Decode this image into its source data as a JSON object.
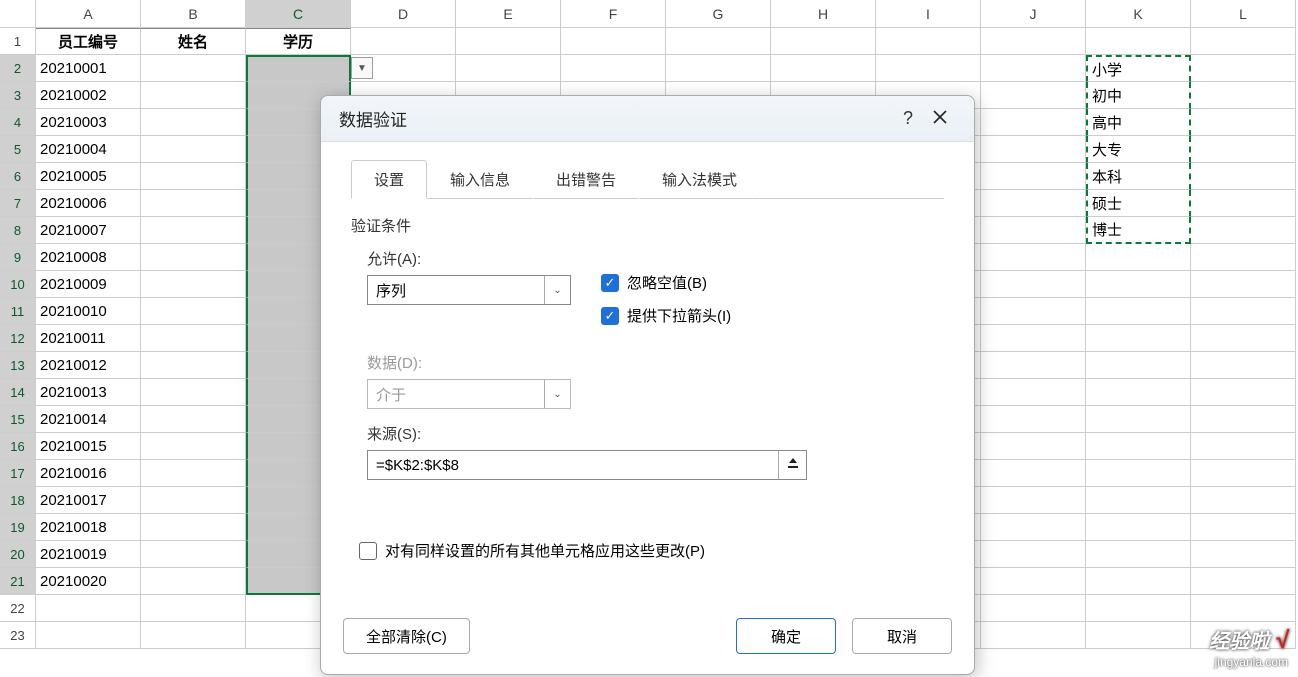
{
  "columns": [
    "A",
    "B",
    "C",
    "D",
    "E",
    "F",
    "G",
    "H",
    "I",
    "J",
    "K",
    "L"
  ],
  "selectedCol": "C",
  "headers": {
    "A": "员工编号",
    "B": "姓名",
    "C": "学历"
  },
  "rows": [
    {
      "n": 1
    },
    {
      "n": 2,
      "A": "20210001"
    },
    {
      "n": 3,
      "A": "20210002"
    },
    {
      "n": 4,
      "A": "20210003"
    },
    {
      "n": 5,
      "A": "20210004"
    },
    {
      "n": 6,
      "A": "20210005"
    },
    {
      "n": 7,
      "A": "20210006"
    },
    {
      "n": 8,
      "A": "20210007"
    },
    {
      "n": 9,
      "A": "20210008"
    },
    {
      "n": 10,
      "A": "20210009"
    },
    {
      "n": 11,
      "A": "20210010"
    },
    {
      "n": 12,
      "A": "20210011"
    },
    {
      "n": 13,
      "A": "20210012"
    },
    {
      "n": 14,
      "A": "20210013"
    },
    {
      "n": 15,
      "A": "20210014"
    },
    {
      "n": 16,
      "A": "20210015"
    },
    {
      "n": 17,
      "A": "20210016"
    },
    {
      "n": 18,
      "A": "20210017"
    },
    {
      "n": 19,
      "A": "20210018"
    },
    {
      "n": 20,
      "A": "20210019"
    },
    {
      "n": 21,
      "A": "20210020"
    },
    {
      "n": 22
    },
    {
      "n": 23
    }
  ],
  "kValues": [
    "小学",
    "初中",
    "高中",
    "大专",
    "本科",
    "硕士",
    "博士"
  ],
  "dialog": {
    "title": "数据验证",
    "help": "?",
    "tabs": {
      "settings": "设置",
      "inputMsg": "输入信息",
      "errorAlert": "出错警告",
      "ime": "输入法模式"
    },
    "sectionLabel": "验证条件",
    "allowLabel": "允许(A):",
    "allowValue": "序列",
    "dataLabel": "数据(D):",
    "dataValue": "介于",
    "ignoreBlank": "忽略空值(B)",
    "inCellDropdown": "提供下拉箭头(I)",
    "sourceLabel": "来源(S):",
    "sourceValue": "=$K$2:$K$8",
    "applyAll": "对有同样设置的所有其他单元格应用这些更改(P)",
    "clearAll": "全部清除(C)",
    "ok": "确定",
    "cancel": "取消"
  },
  "watermark": {
    "brand": "经验啦",
    "url": "jingyanla.com"
  }
}
